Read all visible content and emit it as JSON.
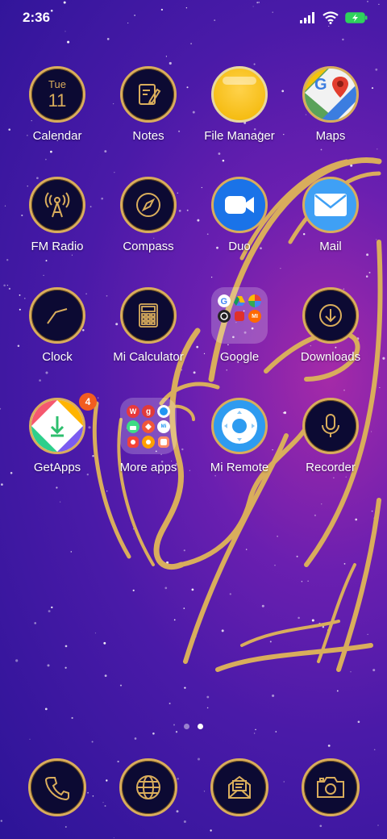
{
  "status": {
    "time": "2:36",
    "battery": "charging"
  },
  "apps": [
    {
      "name": "calendar",
      "label": "Calendar",
      "icon": "calendar-icon",
      "day": "Tue",
      "date": "11"
    },
    {
      "name": "notes",
      "label": "Notes",
      "icon": "notes-icon"
    },
    {
      "name": "file-manager",
      "label": "File Manager",
      "icon": "folder-icon"
    },
    {
      "name": "maps",
      "label": "Maps",
      "icon": "maps-icon"
    },
    {
      "name": "fm-radio",
      "label": "FM Radio",
      "icon": "radio-tower-icon"
    },
    {
      "name": "compass",
      "label": "Compass",
      "icon": "compass-icon"
    },
    {
      "name": "duo",
      "label": "Duo",
      "icon": "video-camera-icon"
    },
    {
      "name": "mail",
      "label": "Mail",
      "icon": "envelope-icon"
    },
    {
      "name": "clock",
      "label": "Clock",
      "icon": "clock-icon"
    },
    {
      "name": "mi-calculator",
      "label": "Mi Calculator",
      "icon": "calculator-icon"
    },
    {
      "name": "google",
      "label": "Google",
      "icon": "google-folder-icon"
    },
    {
      "name": "downloads",
      "label": "Downloads",
      "icon": "download-icon"
    },
    {
      "name": "getapps",
      "label": "GetApps",
      "icon": "getapps-icon",
      "badge": "4"
    },
    {
      "name": "more-apps",
      "label": "More apps",
      "icon": "apps-folder-icon"
    },
    {
      "name": "mi-remote",
      "label": "Mi Remote",
      "icon": "remote-icon"
    },
    {
      "name": "recorder",
      "label": "Recorder",
      "icon": "microphone-icon"
    }
  ],
  "google_folder_text": {
    "mi": "MI"
  },
  "more_apps_text": {
    "wps": "W",
    "g": "g",
    "mi_chat": "Mi"
  },
  "page_indicator": {
    "count": 2,
    "active": 2
  },
  "dock": [
    {
      "name": "phone",
      "icon": "phone-icon"
    },
    {
      "name": "browser",
      "icon": "globe-icon"
    },
    {
      "name": "messaging",
      "icon": "message-icon"
    },
    {
      "name": "camera",
      "icon": "camera-icon"
    }
  ],
  "colors": {
    "gold": "#d9ad5c",
    "icon_bg": "#0c0a33",
    "bg_top": "#2c1497",
    "bg_glow": "#a52aa8",
    "badge": "#f25c1f"
  }
}
